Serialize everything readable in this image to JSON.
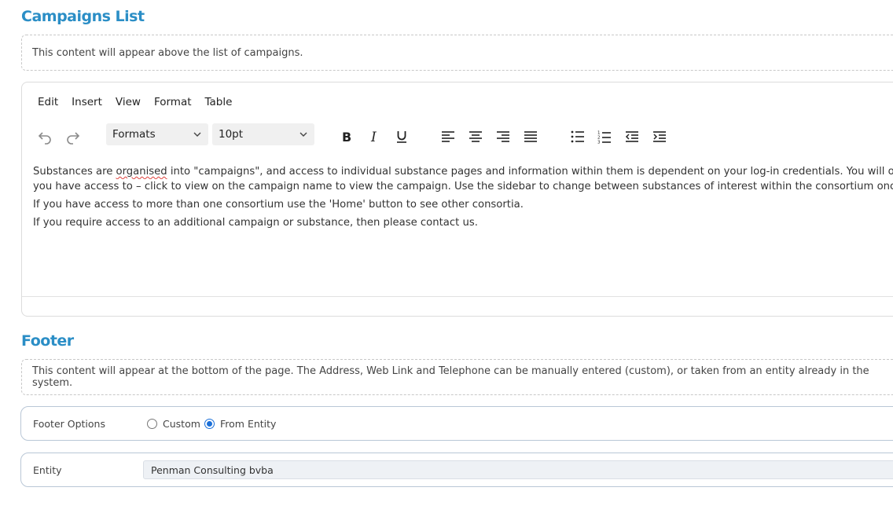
{
  "campaigns": {
    "title": "Campaigns List",
    "hint": "This content will appear above the list of campaigns."
  },
  "editor": {
    "menu": [
      "Edit",
      "Insert",
      "View",
      "Format",
      "Table"
    ],
    "formats_select": "Formats",
    "size_select": "10pt",
    "icons": {
      "undo": "undo-icon",
      "redo": "redo-icon",
      "bold": "bold-icon",
      "italic": "italic-icon",
      "underline": "underline-icon",
      "align_left": "align-left-icon",
      "align_center": "align-center-icon",
      "align_right": "align-right-icon",
      "justify": "align-justify-icon",
      "bullet_list": "bullet-list-icon",
      "numbered_list": "numbered-list-icon",
      "outdent": "outdent-icon",
      "indent": "indent-icon"
    },
    "content": {
      "p1_before": "Substances are ",
      "p1_misspelled": "organised",
      "p1_after": " into \"campaigns\", and access to individual substance pages and information within them is dependent on your log-in credentials. You will only see campaigns",
      "p1_line2": "you have access to – click to view on the campaign name to view the campaign. Use the sidebar to change between substances of interest within the consortium once you have entered.",
      "p2": "If you have access to more than one consortium use the 'Home' button to see other consortia.",
      "p3": "If you require access to an additional campaign or substance, then please contact us."
    }
  },
  "footer": {
    "title": "Footer",
    "hint": "This content will appear at the bottom of the page. The Address, Web Link and Telephone can be manually entered (custom), or taken from an entity already in the system.",
    "options_label": "Footer Options",
    "option_custom": "Custom",
    "option_entity": "From Entity",
    "selected_option": "From Entity",
    "entity_label": "Entity",
    "entity_value": "Penman Consulting bvba"
  },
  "colors": {
    "heading": "#2b8ec6",
    "radio_selected": "#1a6fd8",
    "spellcheck_underline": "#e0403a"
  }
}
